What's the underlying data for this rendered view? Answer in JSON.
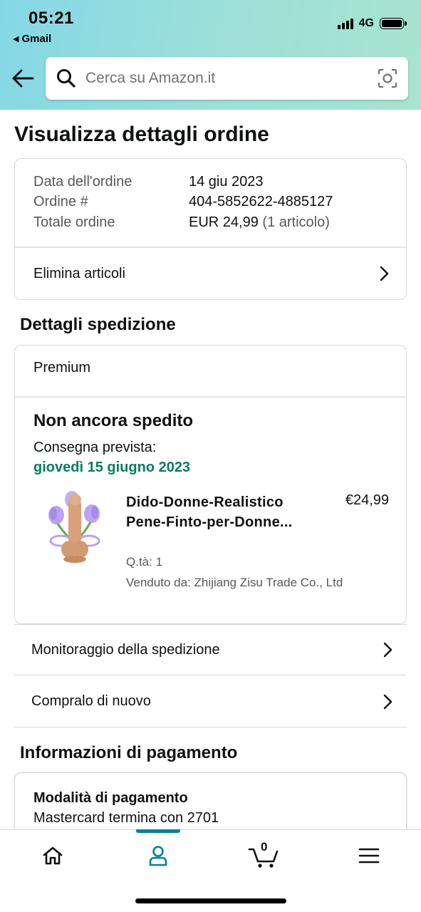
{
  "status_bar": {
    "time": "05:21",
    "back_app": "Gmail",
    "network": "4G"
  },
  "search": {
    "placeholder": "Cerca su Amazon.it"
  },
  "page_title": "Visualizza dettagli ordine",
  "order": {
    "date_label": "Data dell'ordine",
    "date_value": "14 giu 2023",
    "number_label": "Ordine #",
    "number_value": "404-5852622-4885127",
    "total_label": "Totale ordine",
    "total_value": "EUR 24,99",
    "total_items": "(1 articolo)",
    "remove_items": "Elimina articoli"
  },
  "shipping": {
    "section_title": "Dettagli spedizione",
    "service": "Premium",
    "status": "Non ancora spedito",
    "delivery_label": "Consegna prevista:",
    "delivery_date": "giovedì 15 giugno 2023",
    "product": {
      "name": "Dido-Donne-Realistico Pene-Finto-per-Donne...",
      "price": "€24,99",
      "qty": "Q.tà: 1",
      "seller": "Venduto da: Zhijiang Zisu Trade Co., Ltd"
    },
    "track": "Monitoraggio della spedizione",
    "buy_again": "Compralo di nuovo"
  },
  "payment": {
    "section_title": "Informazioni di pagamento",
    "method_title": "Modalità di pagamento",
    "method_value": "Mastercard  termina con 2701"
  },
  "bottom_nav": {
    "cart_count": "0",
    "active": "profile"
  },
  "colors": {
    "delivery_green": "#067D62",
    "nav_accent": "#008296",
    "header_gradient_start": "#84d8e6",
    "header_gradient_end": "#a8e4cf"
  }
}
